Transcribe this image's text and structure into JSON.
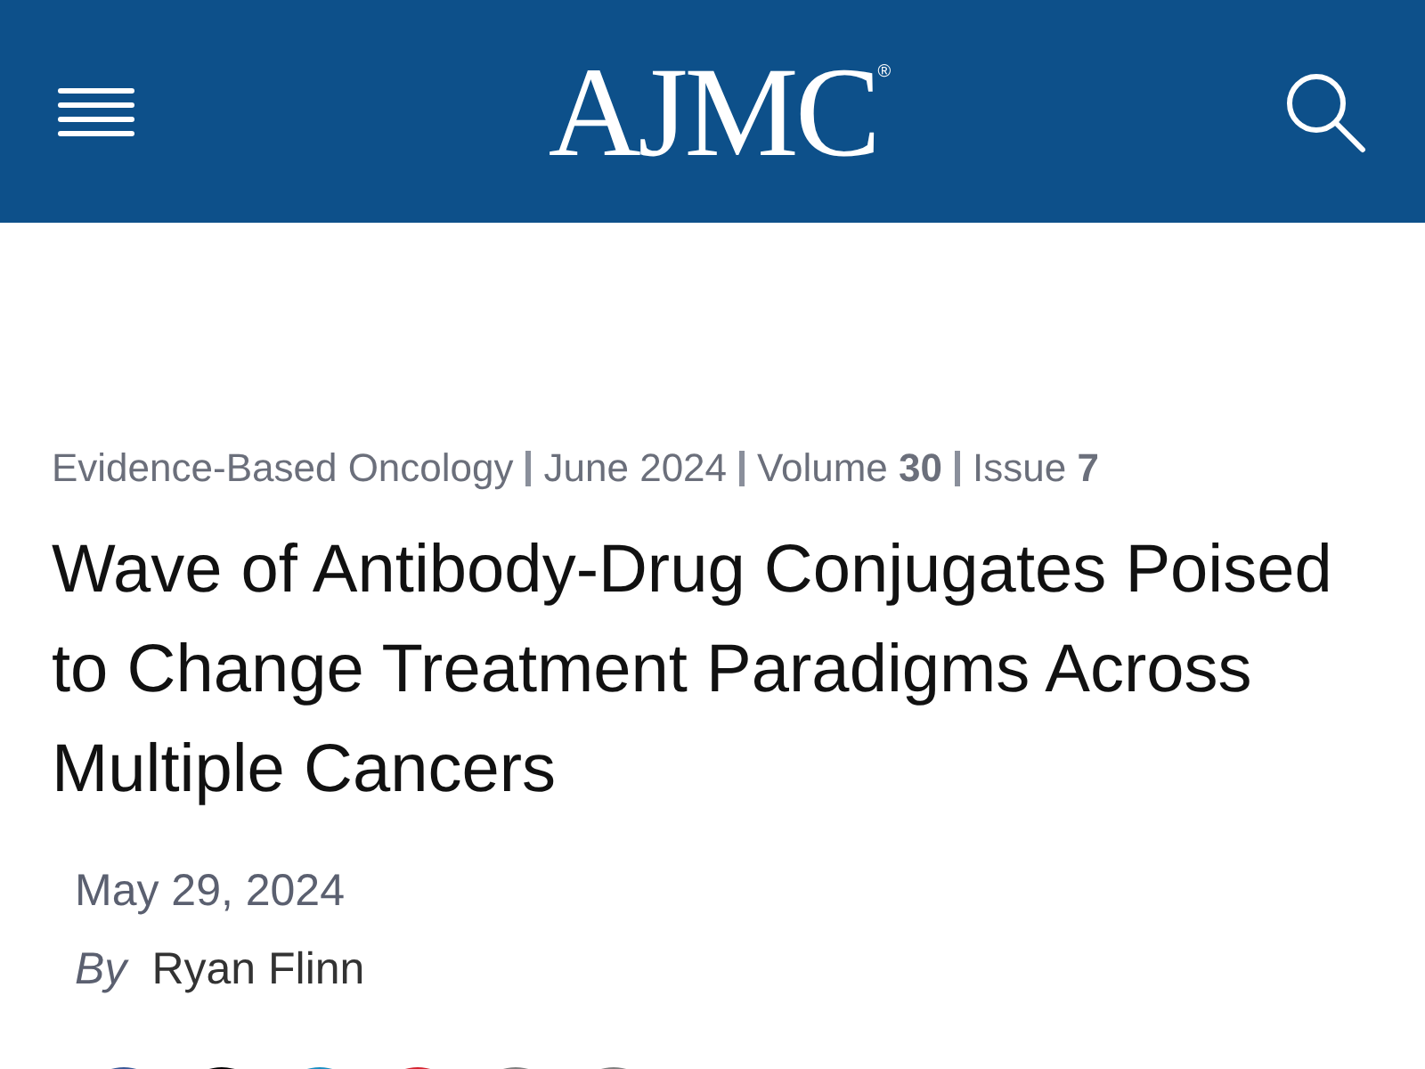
{
  "header": {
    "logo": "AJMC",
    "logo_mark": "®"
  },
  "breadcrumb": [
    "Evidence-Based Oncology",
    "June 2024",
    "Volume **30**",
    "Issue **7**"
  ],
  "article": {
    "title": "Wave of Antibody-Drug Conjugates Poised to Change Treatment Paradigms Across Multiple Cancers",
    "date": "May 29, 2024",
    "byline_prefix": "By",
    "author": "Ryan Flinn"
  },
  "share_buttons": [
    {
      "color": "#3b5998"
    },
    {
      "color": "#000000"
    },
    {
      "color": "#1b8ec2"
    },
    {
      "color": "#d52330"
    },
    {
      "color": "#808080"
    },
    {
      "color": "#808080"
    }
  ]
}
